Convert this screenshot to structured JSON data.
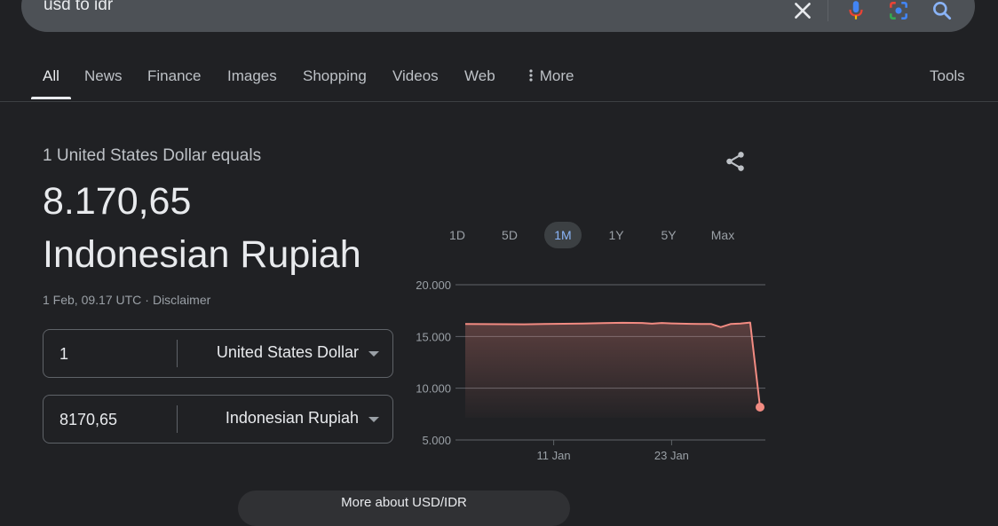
{
  "search": {
    "query": "usd to idr",
    "icons": [
      "clear-icon",
      "microphone-icon",
      "google-lens-icon",
      "search-icon"
    ]
  },
  "tabs": [
    {
      "label": "All",
      "active": true
    },
    {
      "label": "News"
    },
    {
      "label": "Finance"
    },
    {
      "label": "Images"
    },
    {
      "label": "Shopping"
    },
    {
      "label": "Videos"
    },
    {
      "label": "Web"
    },
    {
      "label": "More"
    }
  ],
  "tools_label": "Tools",
  "converter": {
    "equals_text": "1 United States Dollar equals",
    "result_value": "8.170,65",
    "result_currency": "Indonesian Rupiah",
    "timestamp": "1 Feb, 09.17 UTC",
    "separator": "·",
    "disclaimer": "Disclaimer",
    "from": {
      "amount": "1",
      "currency": "United States Dollar"
    },
    "to": {
      "amount": "8170,65",
      "currency": "Indonesian Rupiah"
    }
  },
  "ranges": [
    {
      "label": "1D"
    },
    {
      "label": "5D"
    },
    {
      "label": "1M",
      "active": true
    },
    {
      "label": "1Y"
    },
    {
      "label": "5Y"
    },
    {
      "label": "Max"
    }
  ],
  "bottom_link": "More about USD/IDR",
  "colors": {
    "background": "#202124",
    "line": "#f28b82",
    "active_range": "#8ab4f8"
  },
  "chart_data": {
    "type": "area",
    "title": "",
    "xlabel": "",
    "ylabel": "",
    "y_tick_labels": [
      "20.000",
      "15.000",
      "10.000",
      "5.000"
    ],
    "y_ticks": [
      20000,
      15000,
      10000,
      5000
    ],
    "x_tick_labels": [
      "11 Jan",
      "23 Jan"
    ],
    "ylim": [
      5000,
      20000
    ],
    "x_unit": "day",
    "x_domain": [
      "2 Jan",
      "1 Feb"
    ],
    "x_ticks": [
      "11 Jan",
      "23 Jan"
    ],
    "grid": true,
    "series": [
      {
        "points": [
          [
            "2 Jan",
            16200
          ],
          [
            "4 Jan",
            16190
          ],
          [
            "6 Jan",
            16185
          ],
          [
            "8 Jan",
            16180
          ],
          [
            "10 Jan",
            16200
          ],
          [
            "12 Jan",
            16230
          ],
          [
            "14 Jan",
            16250
          ],
          [
            "16 Jan",
            16300
          ],
          [
            "18 Jan",
            16320
          ],
          [
            "20 Jan",
            16310
          ],
          [
            "21 Jan",
            16240
          ],
          [
            "22 Jan",
            16310
          ],
          [
            "23 Jan",
            16260
          ],
          [
            "24 Jan",
            16240
          ],
          [
            "25 Jan",
            16220
          ],
          [
            "26 Jan",
            16200
          ],
          [
            "27 Jan",
            16210
          ],
          [
            "28 Jan",
            15900
          ],
          [
            "29 Jan",
            16200
          ],
          [
            "30 Jan",
            16250
          ],
          [
            "31 Jan",
            16350
          ],
          [
            "1 Feb",
            8170.65
          ]
        ]
      }
    ]
  }
}
